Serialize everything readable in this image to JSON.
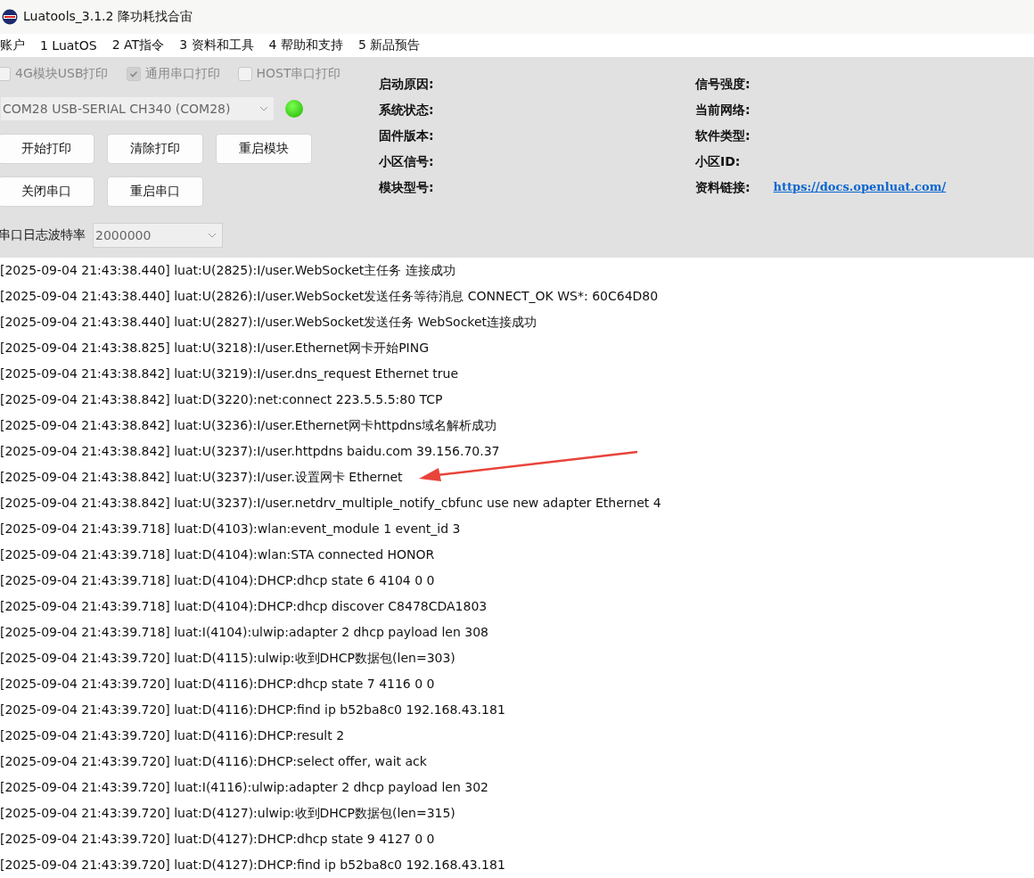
{
  "window": {
    "title": "Luatools_3.1.2 降功耗找合宙"
  },
  "menu": [
    "账户",
    "1 LuatOS",
    "2 AT指令",
    "3 资料和工具",
    "4 帮助和支持",
    "5 新品预告"
  ],
  "print_options": [
    {
      "label": "4G模块USB打印",
      "checked": false
    },
    {
      "label": "通用串口打印",
      "checked": true
    },
    {
      "label": "HOST串口打印",
      "checked": false
    }
  ],
  "port": {
    "value": "COM28 USB-SERIAL CH340 (COM28)",
    "connected": true
  },
  "buttons": [
    [
      "开始打印",
      "清除打印",
      "重启模块"
    ],
    [
      "关闭串口",
      "重启串口"
    ]
  ],
  "baud": {
    "label": "串口日志波特率",
    "value": "2000000"
  },
  "info_left": [
    "启动原因:",
    "系统状态:",
    "固件版本:",
    "小区信号:",
    "模块型号:"
  ],
  "info_right": [
    {
      "label": "信号强度:"
    },
    {
      "label": "当前网络:"
    },
    {
      "label": "软件类型:"
    },
    {
      "label": "小区ID:"
    },
    {
      "label": "资料链接:",
      "link": "https://docs.openluat.com/"
    }
  ],
  "log": [
    "[2025-09-04 21:43:38.440] luat:U(2825):I/user.WebSocket主任务 连接成功",
    "[2025-09-04 21:43:38.440] luat:U(2826):I/user.WebSocket发送任务等待消息 CONNECT_OK WS*: 60C64D80",
    "[2025-09-04 21:43:38.440] luat:U(2827):I/user.WebSocket发送任务 WebSocket连接成功",
    "[2025-09-04 21:43:38.825] luat:U(3218):I/user.Ethernet网卡开始PING",
    "[2025-09-04 21:43:38.842] luat:U(3219):I/user.dns_request Ethernet true",
    "[2025-09-04 21:43:38.842] luat:D(3220):net:connect 223.5.5.5:80 TCP",
    "[2025-09-04 21:43:38.842] luat:U(3236):I/user.Ethernet网卡httpdns域名解析成功",
    "[2025-09-04 21:43:38.842] luat:U(3237):I/user.httpdns baidu.com 39.156.70.37",
    "[2025-09-04 21:43:38.842] luat:U(3237):I/user.设置网卡 Ethernet",
    "[2025-09-04 21:43:38.842] luat:U(3237):I/user.netdrv_multiple_notify_cbfunc use new adapter Ethernet 4",
    "[2025-09-04 21:43:39.718] luat:D(4103):wlan:event_module 1 event_id 3",
    "[2025-09-04 21:43:39.718] luat:D(4104):wlan:STA connected HONOR",
    "[2025-09-04 21:43:39.718] luat:D(4104):DHCP:dhcp state 6 4104 0 0",
    "[2025-09-04 21:43:39.718] luat:D(4104):DHCP:dhcp discover C8478CDA1803",
    "[2025-09-04 21:43:39.718] luat:I(4104):ulwip:adapter 2 dhcp payload len 308",
    "[2025-09-04 21:43:39.720] luat:D(4115):ulwip:收到DHCP数据包(len=303)",
    "[2025-09-04 21:43:39.720] luat:D(4116):DHCP:dhcp state 7 4116 0 0",
    "[2025-09-04 21:43:39.720] luat:D(4116):DHCP:find ip b52ba8c0 192.168.43.181",
    "[2025-09-04 21:43:39.720] luat:D(4116):DHCP:result 2",
    "[2025-09-04 21:43:39.720] luat:D(4116):DHCP:select offer, wait ack",
    "[2025-09-04 21:43:39.720] luat:I(4116):ulwip:adapter 2 dhcp payload len 302",
    "[2025-09-04 21:43:39.720] luat:D(4127):ulwip:收到DHCP数据包(len=315)",
    "[2025-09-04 21:43:39.720] luat:D(4127):DHCP:dhcp state 9 4127 0 0",
    "[2025-09-04 21:43:39.720] luat:D(4127):DHCP:find ip b52ba8c0 192.168.43.181"
  ]
}
